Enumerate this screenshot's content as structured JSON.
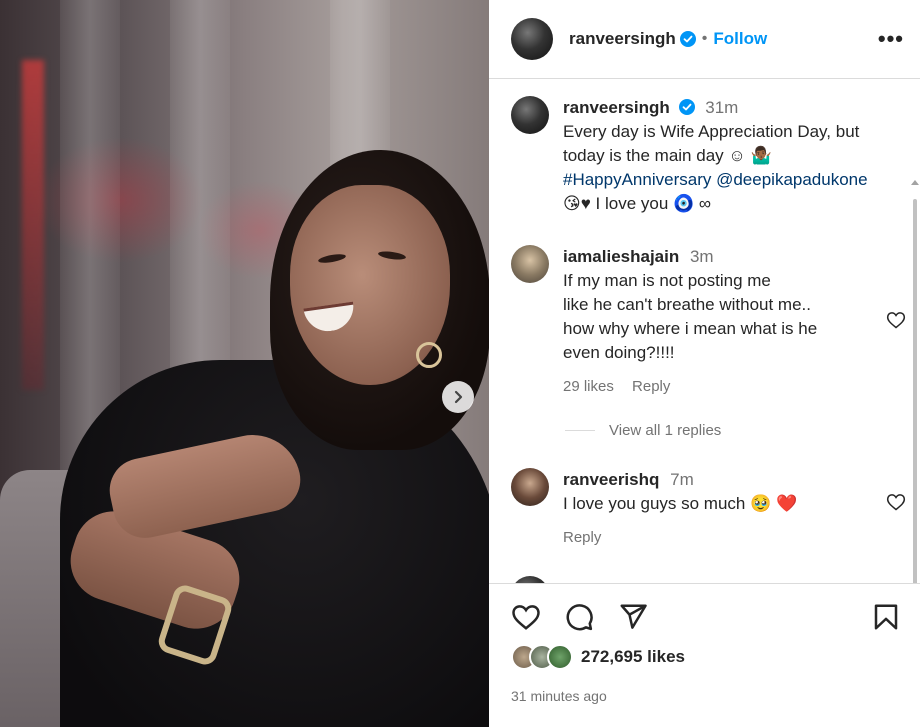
{
  "post": {
    "username": "ranveersingh",
    "follow_label": "Follow",
    "separator": "•",
    "more_label": "•••"
  },
  "caption": {
    "username": "ranveersingh",
    "time": "31m",
    "text_line1": "Every day is Wife Appreciation Day, but",
    "text_line2": "today is the main day ☺ 🤷🏾‍♂️",
    "hashtag": "#HappyAnniversary",
    "mention": "@deepikapadukone",
    "text_line4": "😘♥ I love you 🧿 ∞"
  },
  "comments": [
    {
      "username": "iamalieshajain",
      "time": "3m",
      "lines": [
        "If my man is not posting me",
        "like he can't breathe without me..",
        "how why where i mean what is he",
        "even doing?!!!!"
      ],
      "likes": "29 likes",
      "reply": "Reply",
      "view_replies": "View all 1 replies"
    },
    {
      "username": "ranveerishq",
      "time": "7m",
      "text": "I love you guys so much 🥹 ❤️",
      "reply": "Reply"
    }
  ],
  "footer": {
    "likes": "272,695 likes",
    "posted": "31 minutes ago"
  },
  "icons": {
    "verified": "verified-badge-icon",
    "heart": "heart-icon",
    "comment": "comment-icon",
    "share": "share-icon",
    "save": "bookmark-icon",
    "next": "chevron-right-icon"
  },
  "colors": {
    "accent": "#0095f6",
    "link": "#00376b",
    "muted": "#737373",
    "divider": "#dbdbdb"
  }
}
